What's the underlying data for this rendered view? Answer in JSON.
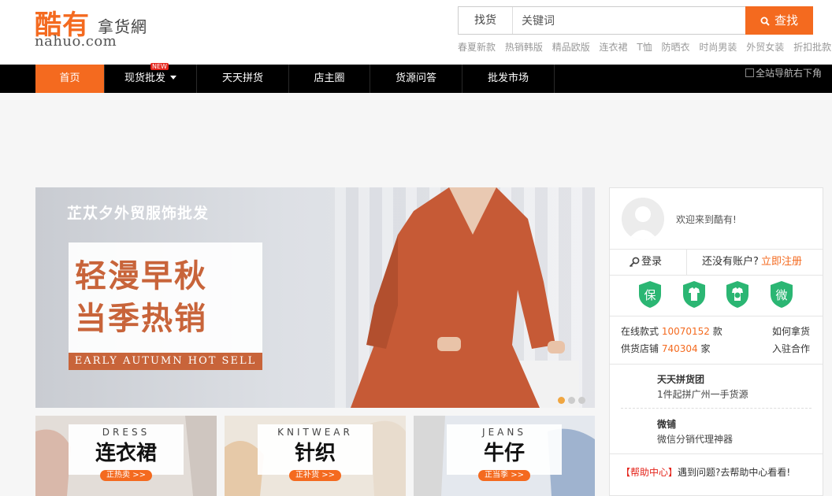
{
  "logo": {
    "main": "酷有",
    "side": "拿货網",
    "domain": "nahuo.com"
  },
  "search": {
    "type_label": "找货",
    "value": "关键词",
    "button_label": "查找"
  },
  "hot_words": [
    "春夏新款",
    "热销韩版",
    "精品欧版",
    "连衣裙",
    "T恤",
    "防晒衣",
    "时尚男装",
    "外贸女装",
    "折扣批款"
  ],
  "nav": {
    "items": [
      {
        "label": "首页",
        "active": true
      },
      {
        "label": "现货批发",
        "badge": "NEW",
        "dropdown": true
      },
      {
        "label": "天天拼货"
      },
      {
        "label": "店主圈"
      },
      {
        "label": "货源问答"
      },
      {
        "label": "批发市场"
      }
    ],
    "corner_image_alt": "全站导航右下角"
  },
  "banner": {
    "subtitle": "芷苁夕外贸服饰批发",
    "headline_1": "轻漫早秋",
    "headline_2": "当季热销",
    "english": "EARLY AUTUMN HOT SELL",
    "slides": 3,
    "current_slide": 1
  },
  "categories": [
    {
      "en": "DRESS",
      "zh": "连衣裙",
      "cta": "正热卖 >>"
    },
    {
      "en": "KNITWEAR",
      "zh": "针织",
      "cta": "正补货 >>"
    },
    {
      "en": "JEANS",
      "zh": "牛仔",
      "cta": "正当季 >>"
    }
  ],
  "sidebar": {
    "welcome": "欢迎来到酷有!",
    "login_label": "登录",
    "register_prompt": "还没有账户?",
    "register_link": "立即注册",
    "badges": [
      {
        "label": "保",
        "icon": "shield-icon"
      },
      {
        "label": "T-shirt",
        "icon": "shirt-icon"
      },
      {
        "label": "time",
        "icon": "clock-shirt-icon"
      },
      {
        "label": "微",
        "icon": "wechat-shield-icon"
      }
    ],
    "stats": {
      "online_prefix": "在线款式",
      "online_value": "10070152",
      "online_suffix": "款",
      "shops_prefix": "供货店铺",
      "shops_value": "740304",
      "shops_suffix": "家",
      "link_1": "如何拿货",
      "link_2": "入驻合作"
    },
    "promos": [
      {
        "title": "天天拼货团",
        "desc": "1件起拼广州一手货源"
      },
      {
        "title": "微铺",
        "desc": "微信分销代理神器"
      }
    ],
    "help_tag": "【帮助中心】",
    "help_text": "遇到问题?去帮助中心看看!"
  },
  "colors": {
    "brand_orange": "#f46a1f",
    "nav_black": "#000000",
    "badge_green": "#2bb673",
    "banner_rust": "#c8643a"
  }
}
